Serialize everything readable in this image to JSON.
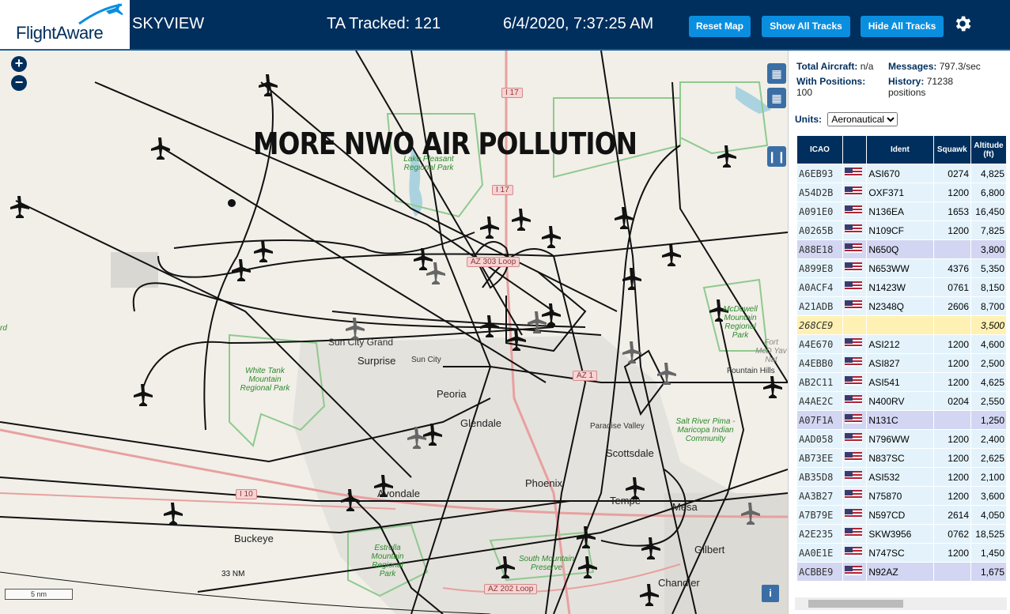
{
  "header": {
    "logo_text": "FlightAware",
    "app_name": "SKYVIEW",
    "tracked": "TA Tracked: 121",
    "datetime": "6/4/2020, 7:37:25 AM",
    "buttons": {
      "reset": "Reset Map",
      "show_all": "Show All Tracks",
      "hide_all": "Hide All Tracks"
    },
    "icons": {
      "settings": "gear-icon",
      "logo": "plane-logo-icon"
    }
  },
  "map": {
    "overlay_title": "MORE NWO AIR POLLUTION",
    "zoom_in": "+",
    "zoom_out": "−",
    "scale_label": "5 nm",
    "range_label": "33 NM",
    "info_label": "i",
    "places": [
      "Sun City Grand",
      "Surprise",
      "Sun City",
      "Peoria",
      "Glendale",
      "Paradise Valley",
      "Scottsdale",
      "Phoenix",
      "Avondale",
      "Tempe",
      "Mesa",
      "Gilbert",
      "Chandler",
      "Buckeye",
      "Fountain Hills",
      "Fort McD Yav Nat",
      "rd"
    ],
    "parks": [
      "Lake Pleasant Regional Park",
      "White Tank Mountain Regional Park",
      "McDowell Mountain Regional Park",
      "Salt River Pima - Maricopa Indian Community",
      "Estrella Mountain Regional Park",
      "South Mountain Preserve"
    ],
    "roads": [
      "I 17",
      "I 17",
      "AZ 303 Loop",
      "I 10",
      "AZ 202 Loop",
      "AZ 1"
    ]
  },
  "sidebar": {
    "stats": {
      "total_label": "Total Aircraft:",
      "total_value": "n/a",
      "messages_label": "Messages:",
      "messages_value": "797.3/sec",
      "positions_label": "With Positions:",
      "positions_value": "100",
      "history_label": "History:",
      "history_value": "71238",
      "history_unit": "positions"
    },
    "units_label": "Units:",
    "units_value": "Aeronautical",
    "columns": [
      "ICAO",
      "",
      "Ident",
      "Squawk",
      "Altitude (ft)"
    ],
    "rows": [
      {
        "icao": "A6EB93",
        "ident": "ASI670",
        "squawk": "0274",
        "alt": "4,825",
        "style": "r0"
      },
      {
        "icao": "A54D2B",
        "ident": "OXF371",
        "squawk": "1200",
        "alt": "6,800",
        "style": "r1"
      },
      {
        "icao": "A091E0",
        "ident": "N136EA",
        "squawk": "1653",
        "alt": "16,450",
        "style": "r0"
      },
      {
        "icao": "A0265B",
        "ident": "N109CF",
        "squawk": "1200",
        "alt": "7,825",
        "style": "r1"
      },
      {
        "icao": "A88E18",
        "ident": "N650Q",
        "squawk": "",
        "alt": "3,800",
        "style": "sel"
      },
      {
        "icao": "A899E8",
        "ident": "N653WW",
        "squawk": "4376",
        "alt": "5,350",
        "style": "r1"
      },
      {
        "icao": "A0ACF4",
        "ident": "N1423W",
        "squawk": "0761",
        "alt": "8,150",
        "style": "r0"
      },
      {
        "icao": "A21ADB",
        "ident": "N2348Q",
        "squawk": "2606",
        "alt": "8,700",
        "style": "r1"
      },
      {
        "icao": "268CE9",
        "ident": "",
        "squawk": "",
        "alt": "3,500",
        "style": "yel"
      },
      {
        "icao": "A4E670",
        "ident": "ASI212",
        "squawk": "1200",
        "alt": "4,600",
        "style": "r1"
      },
      {
        "icao": "A4EBB0",
        "ident": "ASI827",
        "squawk": "1200",
        "alt": "2,500",
        "style": "r0"
      },
      {
        "icao": "AB2C11",
        "ident": "ASI541",
        "squawk": "1200",
        "alt": "4,625",
        "style": "r1"
      },
      {
        "icao": "A4AE2C",
        "ident": "N400RV",
        "squawk": "0204",
        "alt": "2,550",
        "style": "r0"
      },
      {
        "icao": "A07F1A",
        "ident": "N131C",
        "squawk": "",
        "alt": "1,250",
        "style": "sel"
      },
      {
        "icao": "AAD058",
        "ident": "N796WW",
        "squawk": "1200",
        "alt": "2,400",
        "style": "r0"
      },
      {
        "icao": "AB73EE",
        "ident": "N837SC",
        "squawk": "1200",
        "alt": "2,625",
        "style": "r1"
      },
      {
        "icao": "AB35D8",
        "ident": "ASI532",
        "squawk": "1200",
        "alt": "2,100",
        "style": "r0"
      },
      {
        "icao": "AA3B27",
        "ident": "N75870",
        "squawk": "1200",
        "alt": "3,600",
        "style": "r1"
      },
      {
        "icao": "A7B79E",
        "ident": "N597CD",
        "squawk": "2614",
        "alt": "4,050",
        "style": "r0"
      },
      {
        "icao": "A2E235",
        "ident": "SKW3956",
        "squawk": "0762",
        "alt": "18,525",
        "style": "r1"
      },
      {
        "icao": "AA0E1E",
        "ident": "N747SC",
        "squawk": "1200",
        "alt": "1,450",
        "style": "r0"
      },
      {
        "icao": "ACBBE9",
        "ident": "N92AZ",
        "squawk": "",
        "alt": "1,675",
        "style": "sel"
      }
    ]
  }
}
